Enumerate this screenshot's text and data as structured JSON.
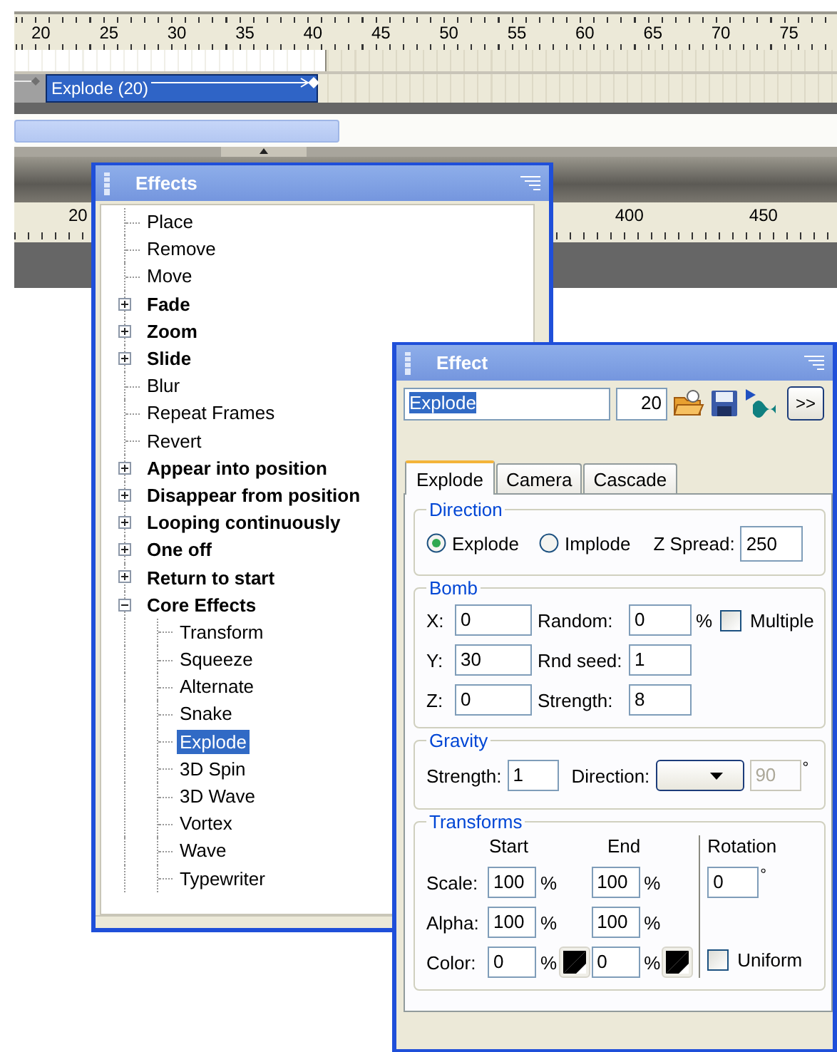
{
  "timeline": {
    "ruler": [
      "20",
      "25",
      "30",
      "35",
      "40",
      "45",
      "50",
      "55",
      "60",
      "65",
      "70",
      "75"
    ],
    "clip": {
      "label": "Explode (20)"
    },
    "lower_ruler": [
      "20",
      "400",
      "450"
    ]
  },
  "effects_panel": {
    "title": "Effects",
    "tree": [
      {
        "label": "Place",
        "selected": false
      },
      {
        "label": "Remove",
        "selected": false
      },
      {
        "label": "Move",
        "selected": false
      },
      {
        "label": "Fade",
        "expanded": false,
        "selected": false
      },
      {
        "label": "Zoom",
        "expanded": false,
        "selected": false
      },
      {
        "label": "Slide",
        "expanded": false,
        "selected": false
      },
      {
        "label": "Blur",
        "selected": false
      },
      {
        "label": "Repeat Frames",
        "selected": false
      },
      {
        "label": "Revert",
        "selected": false
      },
      {
        "label": "Appear into position",
        "expanded": false,
        "selected": false
      },
      {
        "label": "Disappear from position",
        "expanded": false,
        "selected": false
      },
      {
        "label": "Looping continuously",
        "expanded": false,
        "selected": false
      },
      {
        "label": "One off",
        "expanded": false,
        "selected": false
      },
      {
        "label": "Return to start",
        "expanded": false,
        "selected": false
      },
      {
        "label": "Core Effects",
        "expanded": true,
        "selected": false,
        "children": [
          {
            "label": "Transform",
            "selected": false
          },
          {
            "label": "Squeeze",
            "selected": false
          },
          {
            "label": "Alternate",
            "selected": false
          },
          {
            "label": "Snake",
            "selected": false
          },
          {
            "label": "Explode",
            "selected": true
          },
          {
            "label": "3D Spin",
            "selected": false
          },
          {
            "label": "3D Wave",
            "selected": false
          },
          {
            "label": "Vortex",
            "selected": false
          },
          {
            "label": "Wave",
            "selected": false
          },
          {
            "label": "Typewriter",
            "selected": false
          }
        ]
      }
    ]
  },
  "effect_panel": {
    "title": "Effect",
    "name": "Explode",
    "name_selected": true,
    "frames": "20",
    "more_button": ">>",
    "tabs": [
      {
        "label": "Explode",
        "selected": true
      },
      {
        "label": "Camera",
        "selected": false
      },
      {
        "label": "Cascade",
        "selected": false
      }
    ],
    "direction": {
      "title": "Direction",
      "options": [
        {
          "label": "Explode",
          "selected": true
        },
        {
          "label": "Implode",
          "selected": false
        }
      ],
      "z_spread": {
        "label": "Z Spread:",
        "value": "250"
      }
    },
    "bomb": {
      "title": "Bomb",
      "x": {
        "label": "X:",
        "value": "0"
      },
      "random": {
        "label": "Random:",
        "value": "0",
        "unit": "%"
      },
      "multiple": {
        "label": "Multiple",
        "checked": false
      },
      "y": {
        "label": "Y:",
        "value": "30"
      },
      "rnd_seed": {
        "label": "Rnd seed:",
        "value": "1"
      },
      "z": {
        "label": "Z:",
        "value": "0"
      },
      "strength": {
        "label": "Strength:",
        "value": "8"
      }
    },
    "gravity": {
      "title": "Gravity",
      "strength": {
        "label": "Strength:",
        "value": "1"
      },
      "direction": {
        "label": "Direction:",
        "angle": "90",
        "angle_disabled": true,
        "unit": "°"
      }
    },
    "transforms": {
      "title": "Transforms",
      "start_heading": "Start",
      "end_heading": "End",
      "rotation_heading": "Rotation",
      "rows": [
        {
          "kind": "number",
          "label": "Scale:",
          "start": "100",
          "end": "100",
          "unit": "%"
        },
        {
          "kind": "number",
          "label": "Alpha:",
          "start": "100",
          "end": "100",
          "unit": "%"
        },
        {
          "kind": "color",
          "label": "Color:",
          "start": "0",
          "end": "0",
          "unit": "%"
        }
      ],
      "rotation": {
        "value": "0",
        "unit": "°"
      },
      "uniform": {
        "label": "Uniform",
        "checked": false
      }
    }
  }
}
